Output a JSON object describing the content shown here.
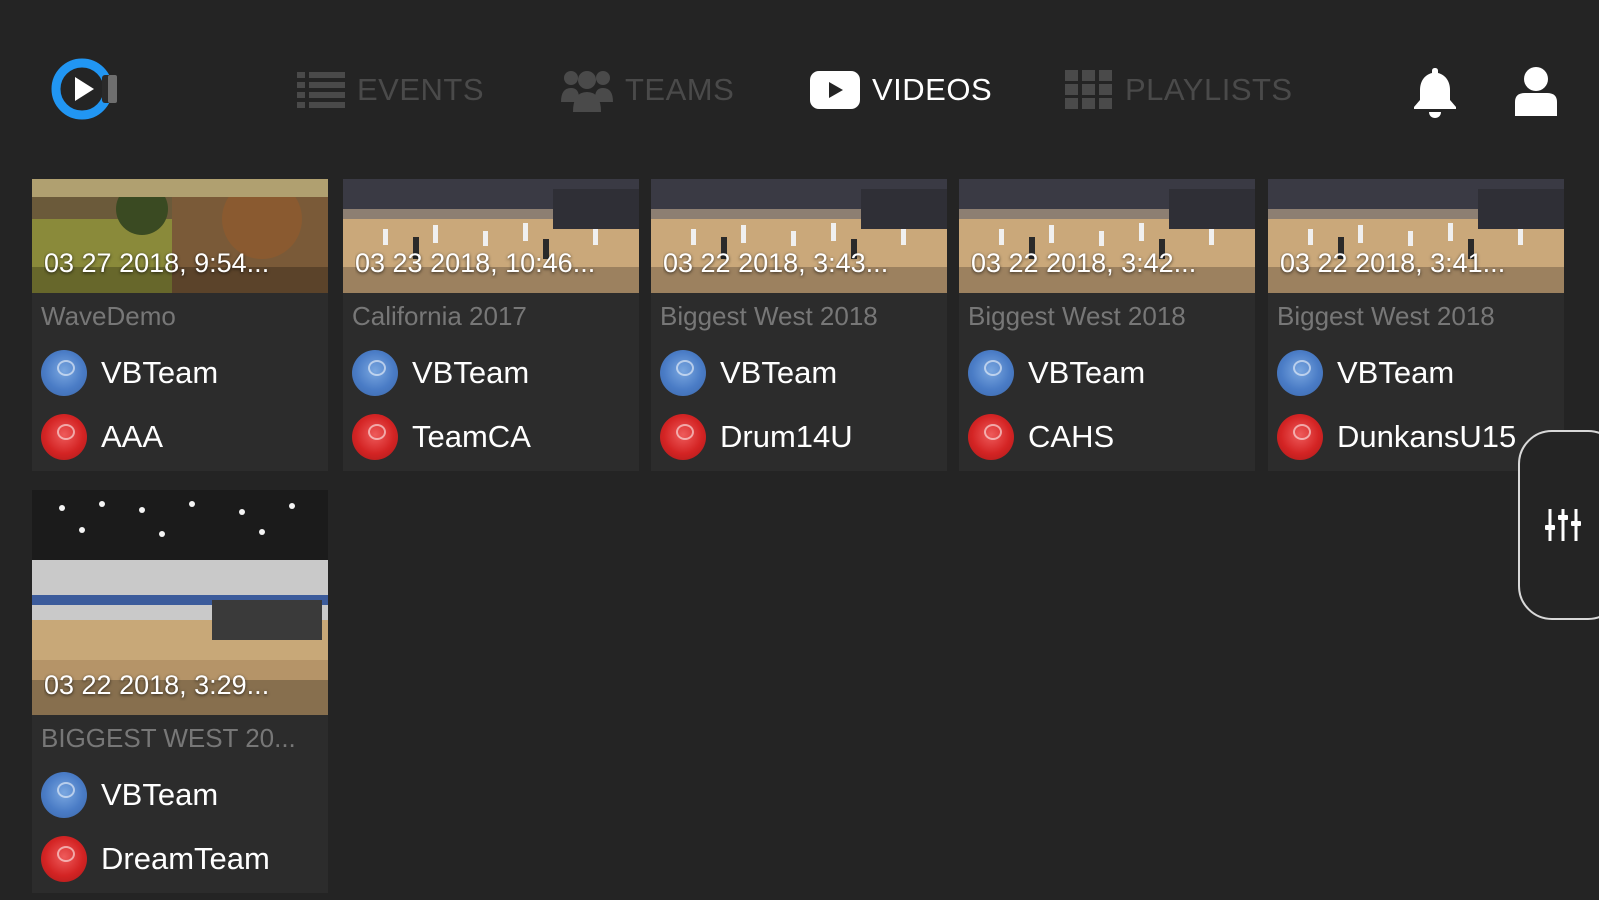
{
  "app": {
    "accent": "#2196F3",
    "logo_icon": "play-circle-logo"
  },
  "nav": {
    "items": [
      {
        "label": "EVENTS",
        "icon": "list-icon",
        "active": false
      },
      {
        "label": "TEAMS",
        "icon": "group-icon",
        "active": false
      },
      {
        "label": "VIDEOS",
        "icon": "play-video-icon",
        "active": true
      },
      {
        "label": "PLAYLISTS",
        "icon": "grid-icon",
        "active": false
      }
    ],
    "right_icons": [
      "bell-icon",
      "user-icon"
    ]
  },
  "videos": [
    {
      "date": "03 27 2018, 9:54...",
      "event": "WaveDemo",
      "home_team": "VBTeam",
      "away_team": "AAA",
      "thumb": "outdoor"
    },
    {
      "date": "03 23 2018, 10:46...",
      "event": "California 2017",
      "home_team": "VBTeam",
      "away_team": "TeamCA",
      "thumb": "gym"
    },
    {
      "date": "03 22 2018, 3:43...",
      "event": "Biggest West 2018",
      "home_team": "VBTeam",
      "away_team": "Drum14U",
      "thumb": "gym"
    },
    {
      "date": "03 22 2018, 3:42...",
      "event": "Biggest West 2018",
      "home_team": "VBTeam",
      "away_team": "CAHS",
      "thumb": "gym"
    },
    {
      "date": "03 22 2018, 3:41...",
      "event": "Biggest West 2018",
      "home_team": "VBTeam",
      "away_team": "DunkansU15",
      "thumb": "gym"
    },
    {
      "date": "03 22 2018, 3:29...",
      "event": "BIGGEST WEST 20...",
      "home_team": "VBTeam",
      "away_team": "DreamTeam",
      "thumb": "gym-wide"
    }
  ],
  "filter": {
    "icon": "sliders-icon"
  }
}
